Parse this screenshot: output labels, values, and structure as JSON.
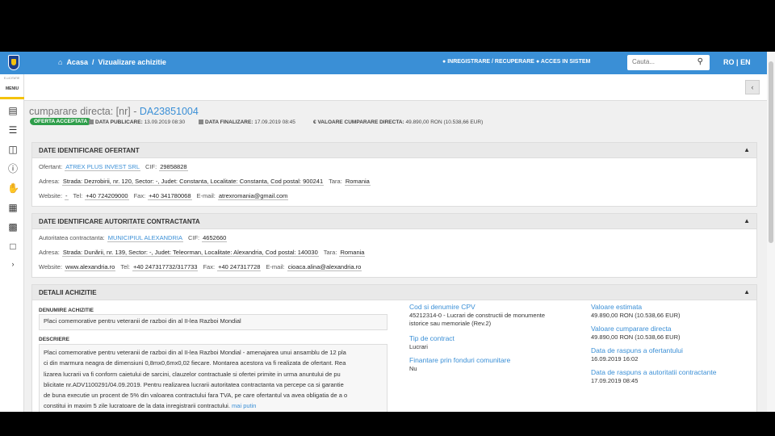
{
  "topbar": {
    "home_label": "Acasa",
    "separator": "/",
    "page_label": "Vizualizare achizitie",
    "register_label": "INREGISTRARE / RECUPERARE",
    "login_label": "ACCES IN SISTEM",
    "search_placeholder": "Cauta...",
    "lang_ro": "RO",
    "lang_sep": "|",
    "lang_en": "EN"
  },
  "sidebar": {
    "small_label": "E-LICITATIE",
    "menu_label": "MENIU",
    "icons": [
      "document-icon",
      "list-edit-icon",
      "shield-doc-icon",
      "help-icon",
      "hand-money-icon",
      "id-card-icon",
      "catalog-icon",
      "chat-icon",
      "expand-icon"
    ]
  },
  "header": {
    "title_prefix": "cumparare directa: [nr] - ",
    "title_code": "DA23851004",
    "status_badge": "OFERTA ACCEPTATA",
    "publish_label": "DATA PUBLICARE:",
    "publish_value": "13.09.2019 08:30",
    "finalize_label": "DATA FINALIZARE:",
    "finalize_value": "17.09.2019 08:45",
    "value_label": "VALOARE CUMPARARE DIRECTA:",
    "value_value": "49.890,00   RON (10.538,66   EUR)"
  },
  "offerer": {
    "title": "DATE IDENTIFICARE OFERTANT",
    "ofertant_label": "Ofertant:",
    "ofertant_value": "ATREX PLUS INVEST SRL",
    "cif_label": "CIF:",
    "cif_value": "29858828",
    "adresa_label": "Adresa:",
    "adresa_value": "Strada: Dezrobirii, nr. 120, Sector: -, Judet: Constanta, Localitate: Constanta, Cod postal: 900241",
    "tara_label": "Tara:",
    "tara_value": "Romania",
    "website_label": "Website:",
    "website_value": "-",
    "tel_label": "Tel:",
    "tel_value": "+40 724209000",
    "fax_label": "Fax:",
    "fax_value": "+40 341780068",
    "email_label": "E-mail:",
    "email_value": "atrexromania@gmail.com"
  },
  "authority": {
    "title": "DATE IDENTIFICARE AUTORITATE CONTRACTANTA",
    "autoritate_label": "Autoritatea contractanta:",
    "autoritate_value": "MUNICIPIUL ALEXANDRIA",
    "cif_label": "CIF:",
    "cif_value": "4652660",
    "adresa_label": "Adresa:",
    "adresa_value": "Strada: Dunării, nr. 139, Sector: -, Judet: Teleorman, Localitate: Alexandria, Cod postal: 140030",
    "tara_label": "Tara:",
    "tara_value": "Romania",
    "website_label": "Website:",
    "website_value": "www.alexandria.ro",
    "tel_label": "Tel:",
    "tel_value": "+40 247317732/317733",
    "fax_label": "Fax:",
    "fax_value": "+40 247317728",
    "email_label": "E-mail:",
    "email_value": "cioaca.alina@alexandria.ro"
  },
  "details": {
    "title": "DETALII ACHIZITIE",
    "denumire_label": "DENUMIRE ACHIZITIE",
    "denumire_value": "Placi comemorative pentru veteranii de razboi din al II-lea Razboi Mondial",
    "descriere_label": "DESCRIERE",
    "descriere_lines": [
      "Placi comemorative pentru veteranii de razboi din al II-lea Razboi Mondial - amenajarea unui ansamblu de 12 pla",
      "ci din marmura neagra de dimensiuni 0,8mx0,6mx0,02 fiecare. Montarea acestora va fi realizata de ofertant. Rea",
      "lizarea lucrarii va fi conform caietului de sarcini, clauzelor contractuale si ofertei primite in urma anuntului de pu",
      "blicitate nr.ADV1100291/04.09.2019. Pentru realizarea lucrarii autoritatea contractanta va percepe ca si garantie",
      "de buna executie un procent de 5% din valoarea contractului fara TVA, pe care ofertantul va avea obligatia de a o",
      "constitui in maxim 5 zile lucratoare de la data inregistrarii contractului."
    ],
    "more_label": "mai putin",
    "cpv_label": "Cod si denumire CPV",
    "cpv_value_1": "45212314-0 - Lucrari de constructii de monumente",
    "cpv_value_2": "istorice sau memoriale (Rev.2)",
    "tip_label": "Tip de contract",
    "tip_value": "Lucrari",
    "finantare_label": "Finantare prin fonduri comunitare",
    "finantare_value": "Nu",
    "val_est_label": "Valoare estimata",
    "val_est_value": "49.890,00   RON (10.538,66   EUR)",
    "val_cd_label": "Valoare cumparare directa",
    "val_cd_value": "49.890,00   RON (10.538,66   EUR)",
    "raspuns_of_label": "Data de raspuns a ofertantului",
    "raspuns_of_value": "16.09.2019 16:02",
    "raspuns_ac_label": "Data de raspuns a autoritatii contractante",
    "raspuns_ac_value": "17.09.2019 08:45"
  },
  "colors": {
    "topbar": "#3a8fd6",
    "badge": "#2e9e4a",
    "link": "#3a8fd6"
  }
}
